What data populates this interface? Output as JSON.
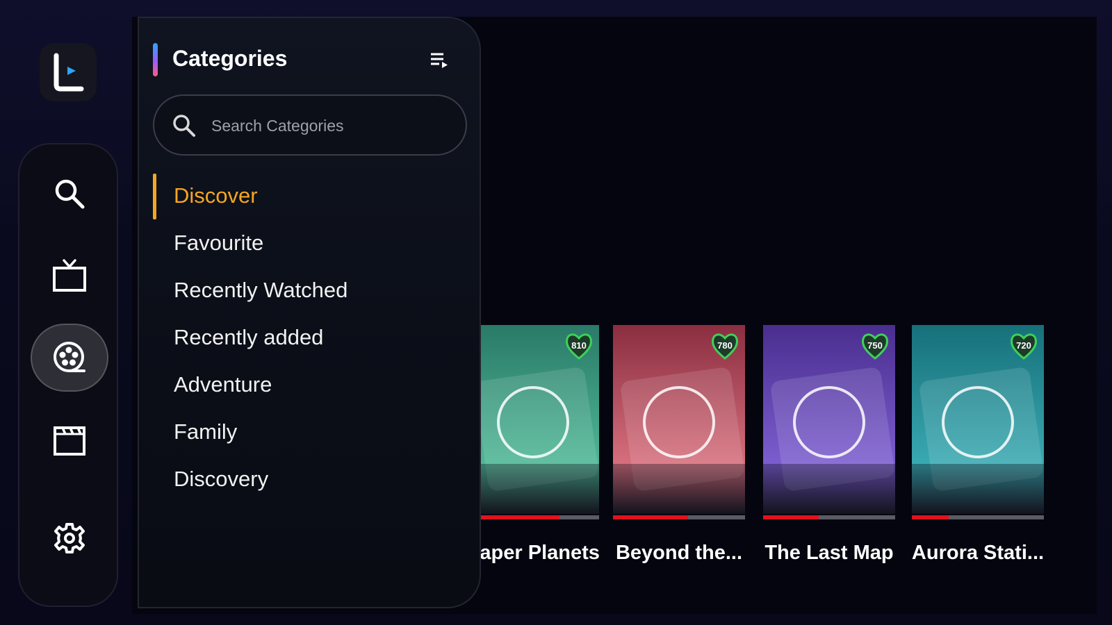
{
  "panel": {
    "title": "Categories",
    "search_placeholder": "Search Categories",
    "items": [
      {
        "label": "Discover",
        "active": true
      },
      {
        "label": "Favourite",
        "active": false
      },
      {
        "label": "Recently Watched",
        "active": false
      },
      {
        "label": "Recently added",
        "active": false
      },
      {
        "label": "Adventure",
        "active": false
      },
      {
        "label": "Family",
        "active": false
      },
      {
        "label": "Discovery",
        "active": false
      }
    ]
  },
  "rail": {
    "items": [
      "search-icon",
      "tv-icon",
      "film-reel-icon",
      "clapperboard-icon",
      "gear-icon"
    ],
    "active_index": 2
  },
  "movies": [
    {
      "title": "Paper Planets",
      "rating": "810",
      "progress": 0.7,
      "colors": [
        "#2a7a68",
        "#4fb896"
      ]
    },
    {
      "title": "Beyond the...",
      "rating": "780",
      "progress": 0.57,
      "colors": [
        "#8a2e40",
        "#d8707e"
      ]
    },
    {
      "title": "The Last Map",
      "rating": "750",
      "progress": 0.42,
      "colors": [
        "#4a2e8e",
        "#7c5ed0"
      ]
    },
    {
      "title": "Aurora Stati...",
      "rating": "720",
      "progress": 0.28,
      "colors": [
        "#16707a",
        "#3aaab2"
      ]
    }
  ],
  "colors": {
    "accent": "#f5a623",
    "progress": "#e0121d",
    "badge_ring": "#3fd05a"
  }
}
